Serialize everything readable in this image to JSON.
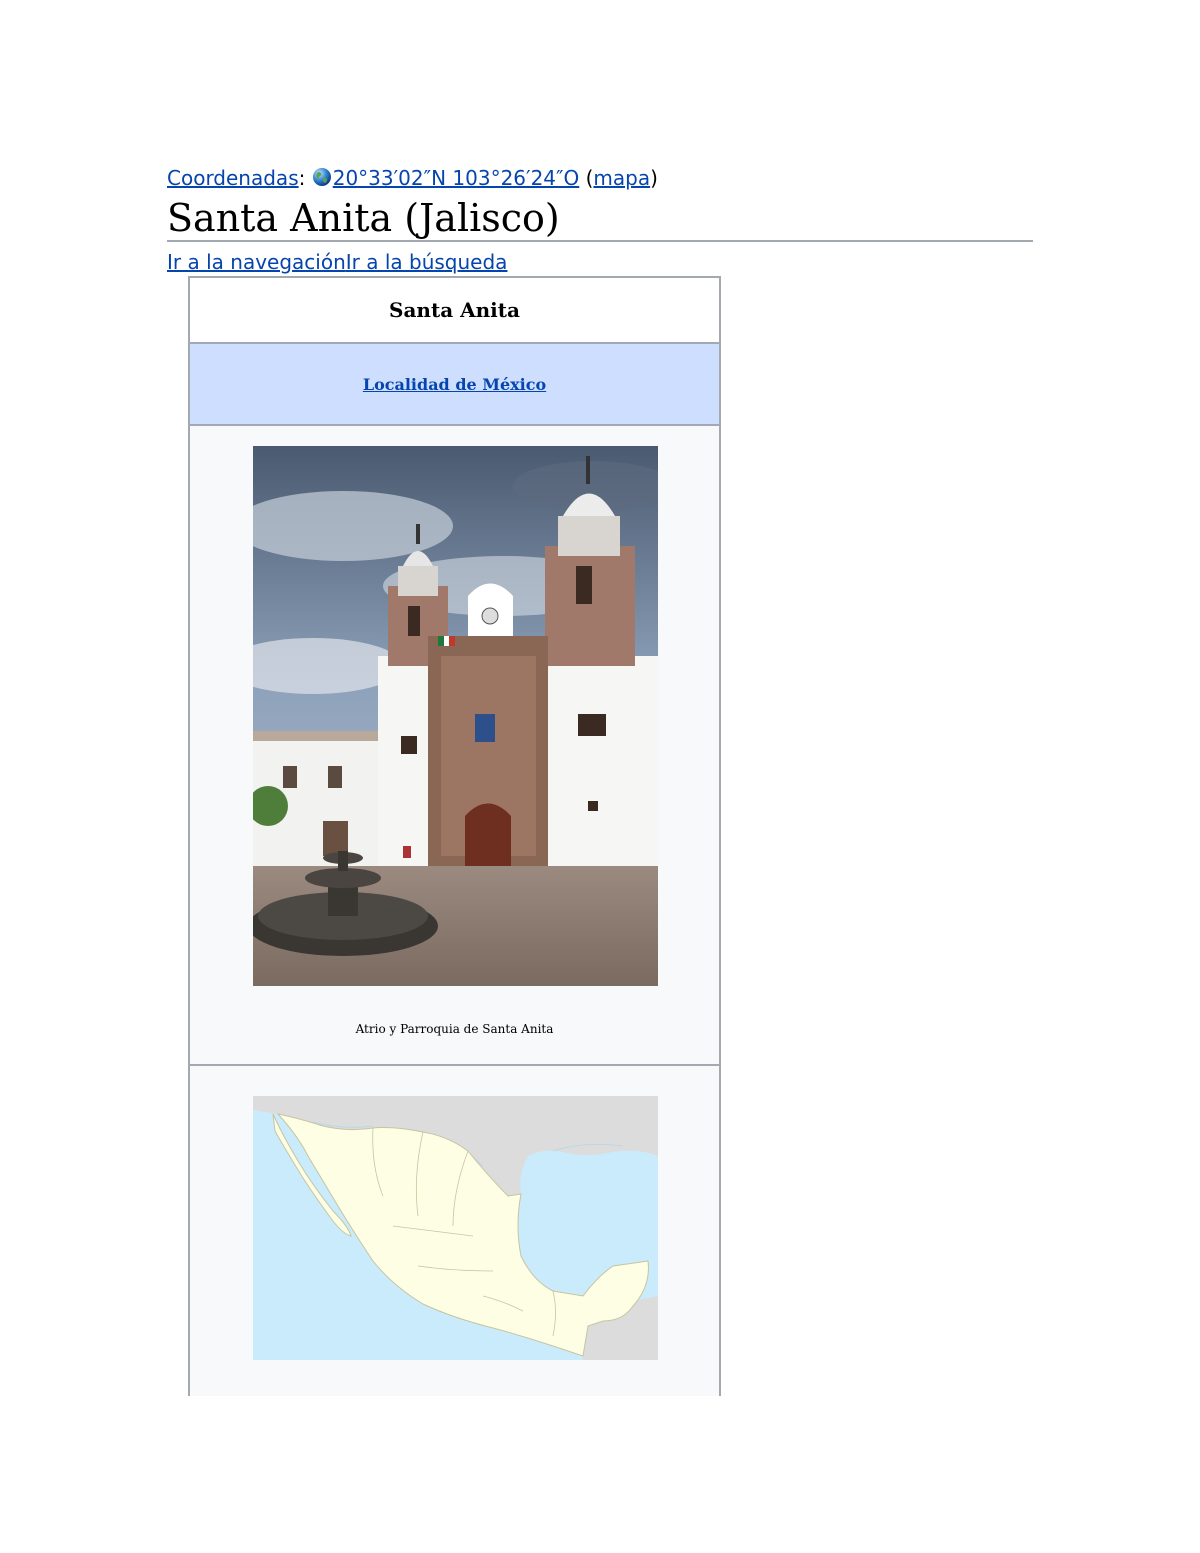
{
  "coords": {
    "label": "Coordenadas",
    "colon": ":",
    "value": "20°33′02″N 103°26′24″O",
    "paren_open": " (",
    "map_link": "mapa",
    "paren_close": ")"
  },
  "page": {
    "title": "Santa Anita (Jalisco)"
  },
  "skip_links": {
    "navigation": "Ir a la navegación",
    "search": "Ir a la búsqueda"
  },
  "infobox": {
    "name": "Santa Anita",
    "type_link": "Localidad de México",
    "photo_caption": "Atrio y Parroquia de Santa Anita",
    "colors": {
      "header_bg": "#cddeff",
      "border": "#a2a9b1",
      "link": "#0645ad"
    }
  }
}
